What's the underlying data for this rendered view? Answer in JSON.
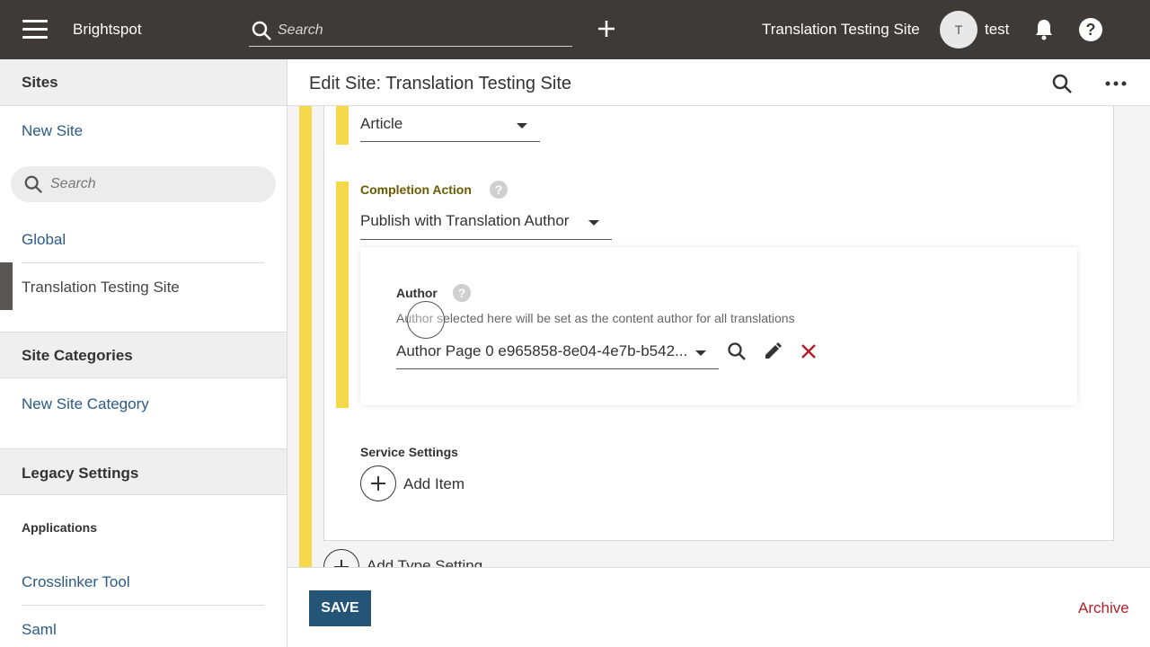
{
  "topbar": {
    "brand": "Brightspot",
    "search_placeholder": "Search",
    "site_name": "Translation Testing Site",
    "avatar_initial": "T",
    "username": "test",
    "help_label": "?"
  },
  "sidebar": {
    "sites_title": "Sites",
    "new_site": "New Site",
    "search_placeholder": "Search",
    "global": "Global",
    "active_site": "Translation Testing Site",
    "site_categories_title": "Site Categories",
    "new_site_category": "New Site Category",
    "legacy_title": "Legacy Settings",
    "applications_label": "Applications",
    "crosslinker": "Crosslinker Tool",
    "saml": "Saml"
  },
  "header": {
    "title": "Edit Site: Translation Testing Site"
  },
  "form": {
    "type_value": "Article",
    "completion_label": "Completion Action",
    "completion_value": "Publish with Translation Author",
    "author_label": "Author",
    "author_desc": "Author selected here will be set as the content author for all translations",
    "author_value": "Author Page 0 e965858-8e04-4e7b-b542...",
    "service_label": "Service Settings",
    "add_item": "Add Item",
    "add_type_setting": "Add Type Setting",
    "help_label": "?"
  },
  "footer": {
    "save": "SAVE",
    "archive": "Archive"
  },
  "colors": {
    "topbar": "#3e3a38",
    "accent_yellow": "#f5d94a",
    "link_blue": "#2a5b85",
    "save_blue": "#245576",
    "archive_red": "#b3202a"
  }
}
